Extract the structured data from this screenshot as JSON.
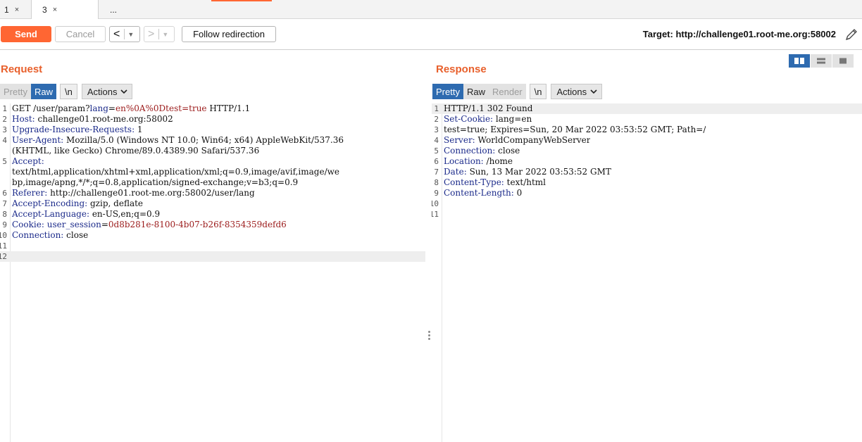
{
  "tabs": [
    {
      "label": "1",
      "close": "×"
    },
    {
      "label": "3",
      "close": "×"
    },
    {
      "label": "..."
    }
  ],
  "toolbar": {
    "send_label": "Send",
    "cancel_label": "Cancel",
    "back_glyph": "<",
    "forward_glyph": ">",
    "dropdown_glyph": "▼",
    "follow_label": "Follow redirection",
    "target_label": "Target: http://challenge01.root-me.org:58002"
  },
  "colors": {
    "accent": "#ff6633",
    "title": "#e8602c",
    "active_blue": "#2e6bb0",
    "header_key": "#1b2a8a",
    "param_value": "#9b1a1a"
  },
  "icons": {
    "edit_target": "pencil-icon",
    "view_side_by_side": "columns-icon",
    "view_horizontal": "rows-icon",
    "view_single": "single-pane-icon",
    "actions_dropdown": "chevron-down-icon"
  },
  "request": {
    "title": "Request",
    "modes": [
      {
        "label": "Pretty",
        "state": "dim"
      },
      {
        "label": "Raw",
        "state": "active"
      }
    ],
    "newline_label": "\\n",
    "actions_label": "Actions",
    "lines": [
      {
        "num": "1",
        "parts": [
          {
            "t": "GET /user/param?",
            "c": ""
          },
          {
            "t": "lang",
            "c": "hk"
          },
          {
            "t": "=",
            "c": ""
          },
          {
            "t": "en%0A%0Dtest=true",
            "c": "hv"
          },
          {
            "t": " HTTP/1.1",
            "c": ""
          }
        ]
      },
      {
        "num": "2",
        "parts": [
          {
            "t": "Host:",
            "c": "hk"
          },
          {
            "t": " challenge01.root-me.org:58002",
            "c": ""
          }
        ]
      },
      {
        "num": "3",
        "parts": [
          {
            "t": "Upgrade-Insecure-Requests:",
            "c": "hk"
          },
          {
            "t": " 1",
            "c": ""
          }
        ]
      },
      {
        "num": "4",
        "parts": [
          {
            "t": "User-Agent:",
            "c": "hk"
          },
          {
            "t": " Mozilla/5.0 (Windows NT 10.0; Win64; x64) AppleWebKit/537.36",
            "c": ""
          }
        ]
      },
      {
        "num": "",
        "parts": [
          {
            "t": "(KHTML, like Gecko) Chrome/89.0.4389.90 Safari/537.36",
            "c": ""
          }
        ]
      },
      {
        "num": "5",
        "parts": [
          {
            "t": "Accept:",
            "c": "hk"
          }
        ]
      },
      {
        "num": "",
        "parts": [
          {
            "t": "text/html,application/xhtml+xml,application/xml;q=0.9,image/avif,image/we",
            "c": ""
          }
        ]
      },
      {
        "num": "",
        "parts": [
          {
            "t": "bp,image/apng,*/*;q=0.8,application/signed-exchange;v=b3;q=0.9",
            "c": ""
          }
        ]
      },
      {
        "num": "6",
        "parts": [
          {
            "t": "Referer:",
            "c": "hk"
          },
          {
            "t": " http://challenge01.root-me.org:58002/user/lang",
            "c": ""
          }
        ]
      },
      {
        "num": "7",
        "parts": [
          {
            "t": "Accept-Encoding:",
            "c": "hk"
          },
          {
            "t": " gzip, deflate",
            "c": ""
          }
        ]
      },
      {
        "num": "8",
        "parts": [
          {
            "t": "Accept-Language:",
            "c": "hk"
          },
          {
            "t": " en-US,en;q=0.9",
            "c": ""
          }
        ]
      },
      {
        "num": "9",
        "parts": [
          {
            "t": "Cookie:",
            "c": "hk"
          },
          {
            "t": " ",
            "c": ""
          },
          {
            "t": "user_session",
            "c": "hk"
          },
          {
            "t": "=",
            "c": ""
          },
          {
            "t": "0d8b281e-8100-4b07-b26f-8354359defd6",
            "c": "hv"
          }
        ]
      },
      {
        "num": "10",
        "parts": [
          {
            "t": "Connection:",
            "c": "hk"
          },
          {
            "t": " close",
            "c": ""
          }
        ]
      },
      {
        "num": "11",
        "parts": []
      },
      {
        "num": "12",
        "parts": [],
        "highlight": true
      }
    ]
  },
  "response": {
    "title": "Response",
    "modes": [
      {
        "label": "Pretty",
        "state": "active"
      },
      {
        "label": "Raw",
        "state": "normal"
      },
      {
        "label": "Render",
        "state": "dim"
      }
    ],
    "newline_label": "\\n",
    "actions_label": "Actions",
    "lines": [
      {
        "num": "1",
        "parts": [
          {
            "t": "HTTP/1.1 302 Found",
            "c": ""
          }
        ],
        "highlight": true
      },
      {
        "num": "2",
        "parts": [
          {
            "t": "Set-Cookie:",
            "c": "hk"
          },
          {
            "t": " lang=en",
            "c": ""
          }
        ]
      },
      {
        "num": "3",
        "parts": [
          {
            "t": "test=true; Expires=Sun, 20 Mar 2022 03:53:52 GMT; Path=/",
            "c": ""
          }
        ]
      },
      {
        "num": "4",
        "parts": [
          {
            "t": "Server:",
            "c": "hk"
          },
          {
            "t": " WorldCompanyWebServer",
            "c": ""
          }
        ]
      },
      {
        "num": "5",
        "parts": [
          {
            "t": "Connection:",
            "c": "hk"
          },
          {
            "t": " close",
            "c": ""
          }
        ]
      },
      {
        "num": "6",
        "parts": [
          {
            "t": "Location:",
            "c": "hk"
          },
          {
            "t": " /home",
            "c": ""
          }
        ]
      },
      {
        "num": "7",
        "parts": [
          {
            "t": "Date:",
            "c": "hk"
          },
          {
            "t": " Sun, 13 Mar 2022 03:53:52 GMT",
            "c": ""
          }
        ]
      },
      {
        "num": "8",
        "parts": [
          {
            "t": "Content-Type:",
            "c": "hk"
          },
          {
            "t": " text/html",
            "c": ""
          }
        ]
      },
      {
        "num": "9",
        "parts": [
          {
            "t": "Content-Length:",
            "c": "hk"
          },
          {
            "t": " 0",
            "c": ""
          }
        ]
      },
      {
        "num": "10",
        "parts": []
      },
      {
        "num": "11",
        "parts": []
      }
    ]
  }
}
